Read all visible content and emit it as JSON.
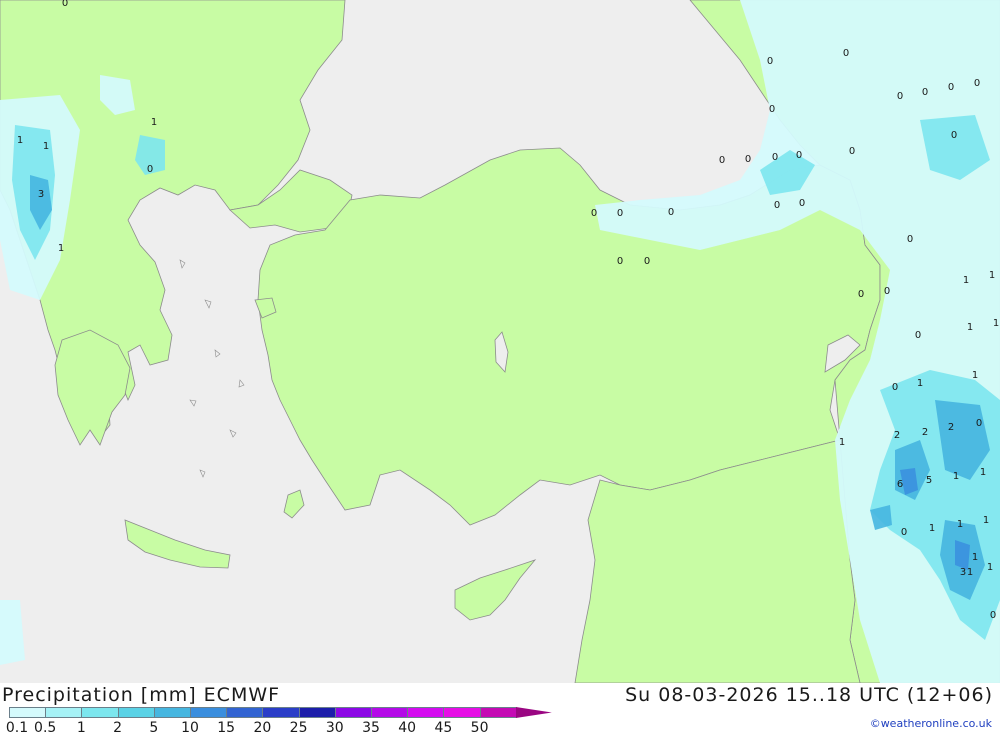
{
  "header": {
    "title": "Precipitation [mm] ECMWF",
    "datetime": "Su 08-03-2026 15..18 UTC (12+06)",
    "credit": "©weatheronline.co.uk"
  },
  "colors": {
    "sea": "#eeeeee",
    "land": "#c8fca4",
    "border": "#8c8c8c",
    "accent": "#1f3fbf"
  },
  "legend": {
    "title": "Precipitation [mm]",
    "colors": [
      "#d4fafc",
      "#a6f2f6",
      "#7ce6ee",
      "#5ad2e6",
      "#46b6e0",
      "#3a8ede",
      "#3264d2",
      "#2a3ec8",
      "#1c1eaa",
      "#8c08e6",
      "#b40ae8",
      "#d40cf0",
      "#e60ee6",
      "#c40ab4",
      "#9a0682"
    ],
    "ticks": [
      "0.1",
      "0.5",
      "1",
      "2",
      "5",
      "10",
      "15",
      "20",
      "25",
      "30",
      "35",
      "40",
      "45",
      "50"
    ]
  },
  "map_labels": [
    "0",
    "0",
    "0",
    "0",
    "0",
    "0",
    "0",
    "0",
    "0",
    "0",
    "0",
    "0",
    "0",
    "0",
    "0",
    "0",
    "0",
    "0",
    "0",
    "0",
    "0",
    "0",
    "0",
    "0",
    "0",
    "0",
    "0",
    "0",
    "0",
    "0",
    "1",
    "1",
    "1",
    "1",
    "1",
    "1",
    "1",
    "1",
    "1",
    "1",
    "1",
    "1",
    "1",
    "1",
    "1",
    "1",
    "1",
    "1",
    "1",
    "2",
    "2",
    "2",
    "3",
    "3",
    "5",
    "6"
  ]
}
